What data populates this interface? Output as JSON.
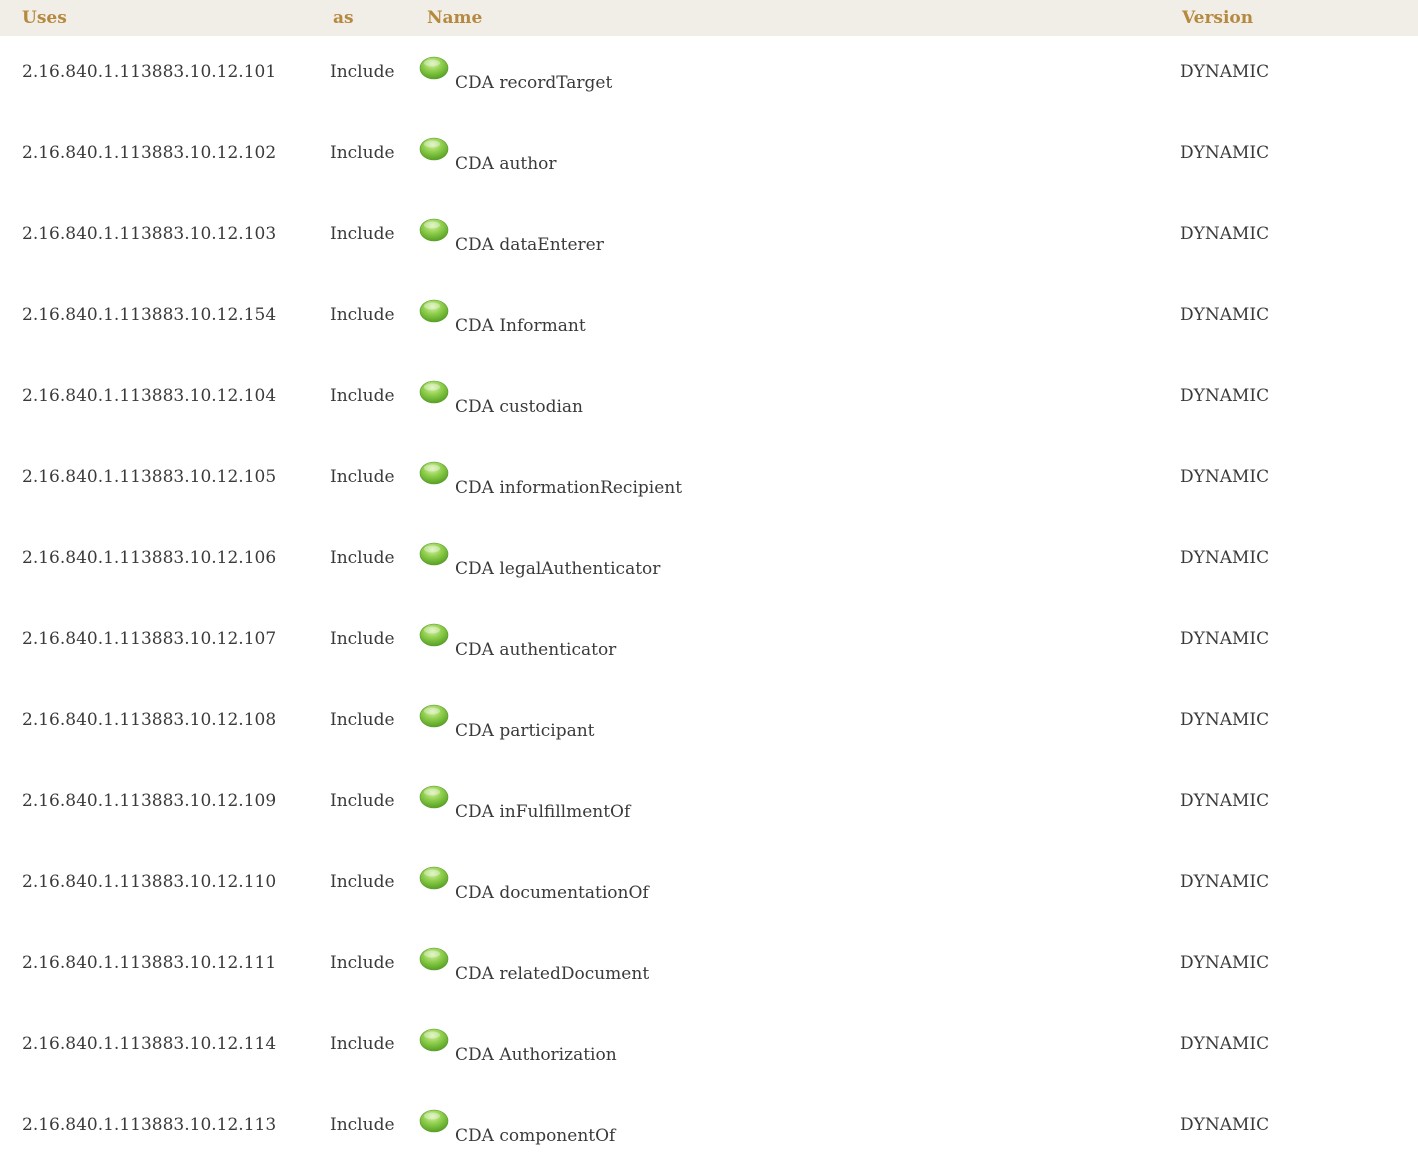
{
  "table": {
    "headers": {
      "uses": "Uses",
      "as": "as",
      "name": "Name",
      "version": "Version"
    },
    "rows": [
      {
        "oid": "2.16.840.1.113883.10.12.101",
        "as": "Include",
        "name": "CDA recordTarget",
        "version": "DYNAMIC"
      },
      {
        "oid": "2.16.840.1.113883.10.12.102",
        "as": "Include",
        "name": "CDA author",
        "version": "DYNAMIC"
      },
      {
        "oid": "2.16.840.1.113883.10.12.103",
        "as": "Include",
        "name": "CDA dataEnterer",
        "version": "DYNAMIC"
      },
      {
        "oid": "2.16.840.1.113883.10.12.154",
        "as": "Include",
        "name": "CDA Informant",
        "version": "DYNAMIC"
      },
      {
        "oid": "2.16.840.1.113883.10.12.104",
        "as": "Include",
        "name": "CDA custodian",
        "version": "DYNAMIC"
      },
      {
        "oid": "2.16.840.1.113883.10.12.105",
        "as": "Include",
        "name": "CDA informationRecipient",
        "version": "DYNAMIC"
      },
      {
        "oid": "2.16.840.1.113883.10.12.106",
        "as": "Include",
        "name": "CDA legalAuthenticator",
        "version": "DYNAMIC"
      },
      {
        "oid": "2.16.840.1.113883.10.12.107",
        "as": "Include",
        "name": "CDA authenticator",
        "version": "DYNAMIC"
      },
      {
        "oid": "2.16.840.1.113883.10.12.108",
        "as": "Include",
        "name": "CDA participant",
        "version": "DYNAMIC"
      },
      {
        "oid": "2.16.840.1.113883.10.12.109",
        "as": "Include",
        "name": "CDA inFulfillmentOf",
        "version": "DYNAMIC"
      },
      {
        "oid": "2.16.840.1.113883.10.12.110",
        "as": "Include",
        "name": "CDA documentationOf",
        "version": "DYNAMIC"
      },
      {
        "oid": "2.16.840.1.113883.10.12.111",
        "as": "Include",
        "name": "CDA relatedDocument",
        "version": "DYNAMIC"
      },
      {
        "oid": "2.16.840.1.113883.10.12.114",
        "as": "Include",
        "name": "CDA Authorization",
        "version": "DYNAMIC"
      },
      {
        "oid": "2.16.840.1.113883.10.12.113",
        "as": "Include",
        "name": "CDA componentOf",
        "version": "DYNAMIC"
      }
    ]
  },
  "icons": {
    "status": "green-status-dot-icon"
  },
  "colors": {
    "header_background": "#f1eee7",
    "header_text": "#b5893f",
    "body_text": "#3a3a3a",
    "status_green": "#7ec242"
  }
}
